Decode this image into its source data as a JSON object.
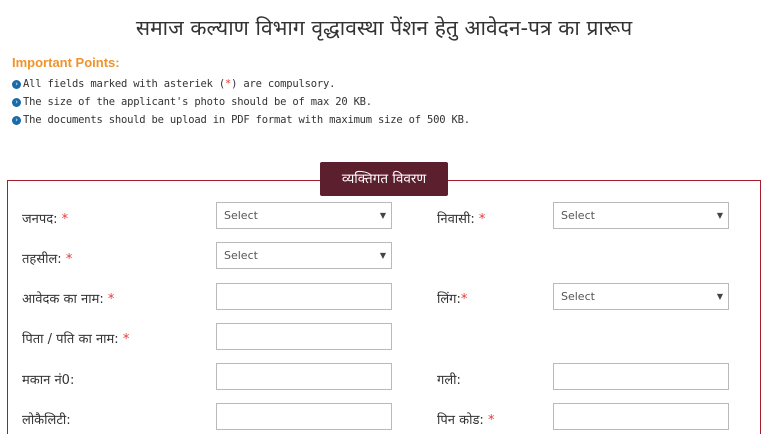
{
  "title": "समाज कल्याण विभाग वृद्धावस्था पेंशन हेतु आवेदन-पत्र का प्रारूप",
  "important": {
    "heading": "Important Points:",
    "points": [
      {
        "pre": "All fields marked with asteriek ( ",
        "star": "*",
        "post": " ) are compulsory."
      },
      {
        "text": "The size of the applicant's photo should be of max 20 KB."
      },
      {
        "text": "The documents should be upload in PDF format with maximum size of 500 KB."
      }
    ],
    "bullet_icon": "chevron-right-circle-icon"
  },
  "section": {
    "legend": "व्यक्तिगत विवरण"
  },
  "fields": {
    "janpad": {
      "label": "जनपद:",
      "required": "*",
      "value": "Select"
    },
    "niwasi": {
      "label": "निवासी:",
      "required": "*",
      "value": "Select"
    },
    "tehsil": {
      "label": "तहसील:",
      "required": "*",
      "value": "Select"
    },
    "applicant_name": {
      "label": "आवेदक का नाम:",
      "required": "*",
      "value": ""
    },
    "gender": {
      "label": "लिंग:",
      "required": "*",
      "value": "Select"
    },
    "father_husband_name": {
      "label": "पिता / पति का नाम:",
      "required": "*",
      "value": ""
    },
    "house_no": {
      "label": "मकान नं0:",
      "value": ""
    },
    "street": {
      "label": "गली:",
      "value": ""
    },
    "locality": {
      "label": "लोकैलिटी:",
      "value": ""
    },
    "pin_code": {
      "label": "पिन कोड:",
      "required": "*",
      "value": ""
    }
  },
  "colors": {
    "accent_orange": "#f0932b",
    "legend_bg": "#5b1f2e",
    "border_red": "#a51d2d",
    "required_red": "#e53935",
    "bullet_blue": "#1a6aa8"
  }
}
